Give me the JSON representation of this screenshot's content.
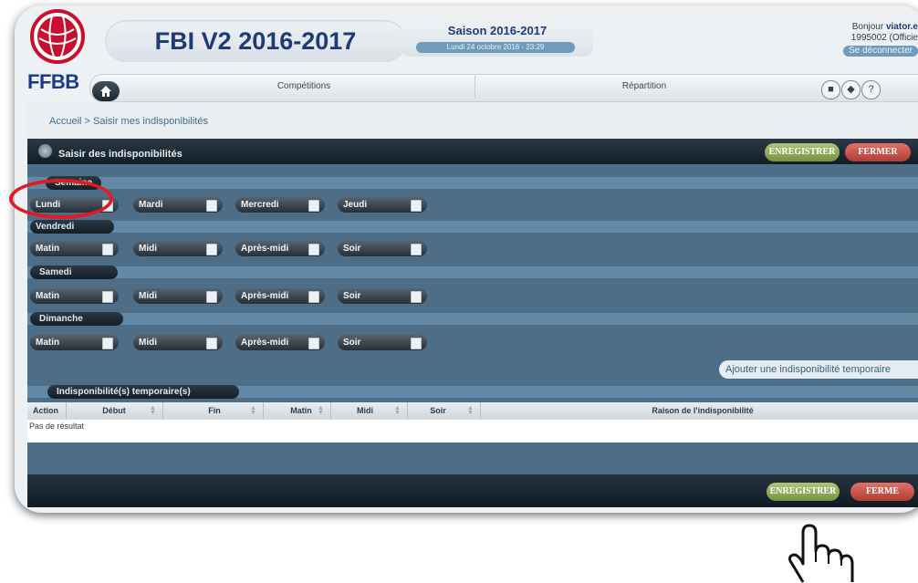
{
  "header": {
    "logo_text": "FFBB",
    "app_title": "FBI V2 2016-2017",
    "season_title": "Saison 2016-2017",
    "season_date": "Lundi 24 octobre 2016 - 23:29",
    "greeting": "Bonjour ",
    "username": "viator.e",
    "user_id": "1995002 (Officie",
    "logout_label": "Se déconnecter"
  },
  "nav": {
    "items": [
      "Compétitions",
      "Répartition"
    ],
    "icons": [
      "chat-icon",
      "tag-icon",
      "help-icon"
    ]
  },
  "breadcrumb": "Accueil > Saisir mes indisponibilités",
  "panel": {
    "title": "Saisir des indisponibilités",
    "save_label": "ENREGISTRER",
    "close_label": "FERMER",
    "close_label_partial": "FERME"
  },
  "sections": {
    "semaine": "Semaine",
    "vendredi": "Vendredi",
    "samedi": "Samedi",
    "dimanche": "Dimanche",
    "temp": "Indisponibilité(s) temporaire(s)"
  },
  "weekdays": [
    "Lundi",
    "Mardi",
    "Mercredi",
    "Jeudi"
  ],
  "slots": [
    "Matin",
    "Midi",
    "Après-midi",
    "Soir"
  ],
  "add_temp_label": "Ajouter une indisponibilité temporaire",
  "table": {
    "columns": [
      "Action",
      "Début",
      "Fin",
      "Matin",
      "Midi",
      "Soir",
      "Raison de l'indisponibilité"
    ],
    "empty_text": "Pas de résultat"
  }
}
